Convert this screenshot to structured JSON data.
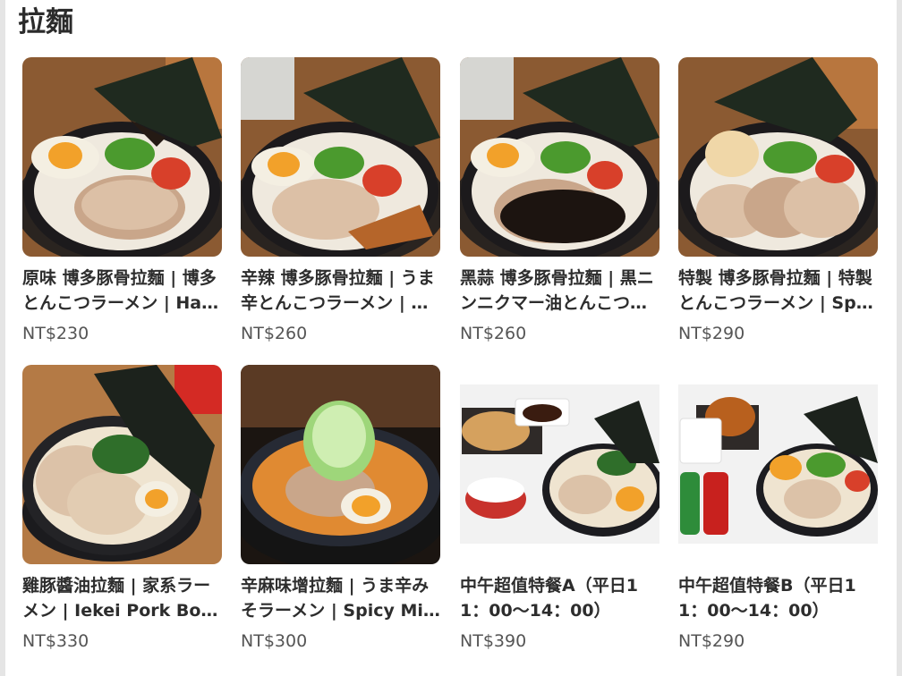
{
  "section": {
    "title": "拉麵"
  },
  "items": [
    {
      "name": "原味 博多豚骨拉麵 | 博多とんこつラーメン | Hakata Tonkotsu Ramen",
      "price": "NT$230"
    },
    {
      "name": "辛辣 博多豚骨拉麵 | うま辛とんこつラーメン | Spicy Tonkotsu Ramen",
      "price": "NT$260"
    },
    {
      "name": "黑蒜 博多豚骨拉麵 | 黒ニンニクマー油とんこつラーメン",
      "price": "NT$260"
    },
    {
      "name": "特製 博多豚骨拉麵 | 特製とんこつラーメン | Special Ramen",
      "price": "NT$290"
    },
    {
      "name": "雞豚醬油拉麵 | 家系ラーメン | Iekei Pork Bone Ramen",
      "price": "NT$330"
    },
    {
      "name": "辛麻味增拉麵 | うま辛みそラーメン | Spicy Miso Ramen",
      "price": "NT$300"
    },
    {
      "name": "中午超值特餐A（平日11：00〜14：00）",
      "price": "NT$390"
    },
    {
      "name": "中午超值特餐B（平日11：00〜14：00）",
      "price": "NT$290"
    }
  ]
}
